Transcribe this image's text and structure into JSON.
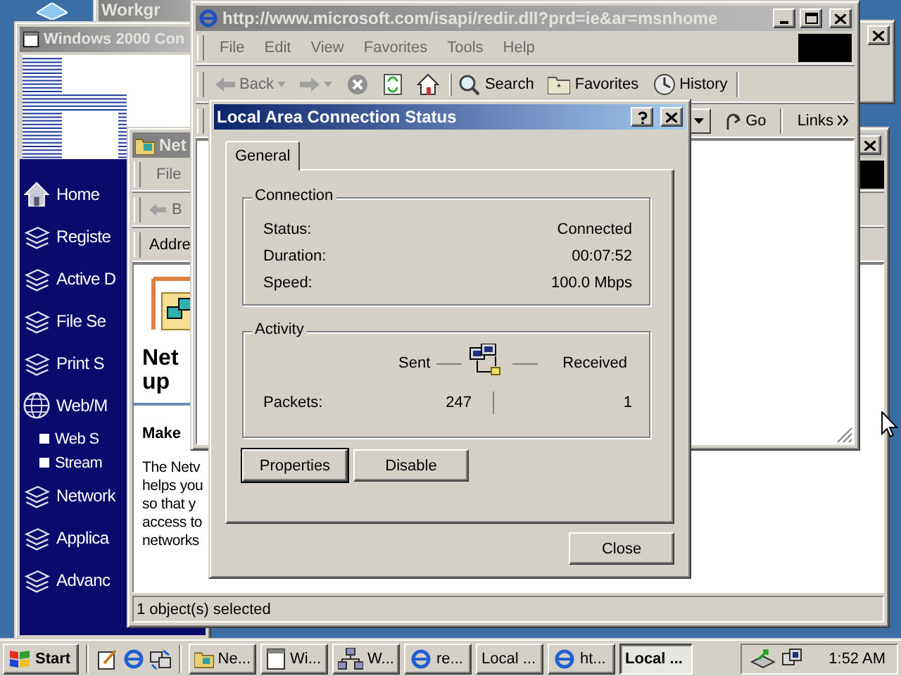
{
  "workgroup_window": {
    "title": "Workgr"
  },
  "configure_window": {
    "title": "Windows 2000 Con",
    "sidebar_items": [
      {
        "label": "Home",
        "kind": "home"
      },
      {
        "label": "Registe",
        "kind": "main"
      },
      {
        "label": "Active D",
        "kind": "main"
      },
      {
        "label": "File Se",
        "kind": "main"
      },
      {
        "label": "Print S",
        "kind": "main"
      },
      {
        "label": "Web/M",
        "kind": "web"
      },
      {
        "label": "Web S",
        "kind": "sub"
      },
      {
        "label": "Stream",
        "kind": "sub"
      },
      {
        "label": "Network",
        "kind": "main"
      },
      {
        "label": "Applica",
        "kind": "main"
      },
      {
        "label": "Advanc",
        "kind": "main"
      }
    ]
  },
  "network_window": {
    "title": "Net",
    "menu": [
      "File"
    ],
    "back": "B",
    "address_label": "Addre",
    "heading_lines": [
      "Net",
      "up"
    ],
    "subheading": "Make",
    "paragraph_lines": [
      "The Netv",
      "helps you",
      "so that y",
      "access to",
      "networks"
    ],
    "status_bar": "1 object(s) selected"
  },
  "browser_window": {
    "title": "http://www.microsoft.com/isapi/redir.dll?prd=ie&ar=msnhome",
    "menu": [
      "File",
      "Edit",
      "View",
      "Favorites",
      "Tools",
      "Help"
    ],
    "toolbar": [
      {
        "label": "Back",
        "kind": "back"
      },
      {
        "kind": "forward"
      },
      {
        "kind": "stop"
      },
      {
        "kind": "refresh"
      },
      {
        "kind": "home"
      },
      {
        "label": "Search",
        "kind": "search"
      },
      {
        "label": "Favorites",
        "kind": "favorites"
      },
      {
        "label": "History",
        "kind": "history"
      }
    ],
    "go": "Go",
    "links": "Links"
  },
  "dialog": {
    "title": "Local Area Connection Status",
    "tabs": [
      {
        "label": "General",
        "selected": true
      }
    ],
    "connection": {
      "title": "Connection",
      "rows": [
        {
          "label": "Status:",
          "value": "Connected"
        },
        {
          "label": "Duration:",
          "value": "00:07:52"
        },
        {
          "label": "Speed:",
          "value": "100.0 Mbps"
        }
      ]
    },
    "activity": {
      "title": "Activity",
      "sent_label": "Sent",
      "received_label": "Received",
      "packets_label": "Packets:",
      "sent_value": "247",
      "received_value": "1"
    },
    "buttons": [
      "Properties",
      "Disable"
    ],
    "close": "Close"
  },
  "taskbar": {
    "start": "Start",
    "tasks": [
      {
        "label": "Ne...",
        "kind": "folder",
        "selected": false
      },
      {
        "label": "Wi...",
        "kind": "window",
        "selected": false
      },
      {
        "label": "W...",
        "kind": "network",
        "selected": false
      },
      {
        "label": "re...",
        "kind": "browser",
        "selected": false
      },
      {
        "label": "Local ...",
        "kind": "none",
        "selected": false
      },
      {
        "label": "ht...",
        "kind": "browser",
        "selected": false
      },
      {
        "label": "Local ...",
        "kind": "none",
        "selected": true
      }
    ],
    "clock": "1:52 AM"
  }
}
